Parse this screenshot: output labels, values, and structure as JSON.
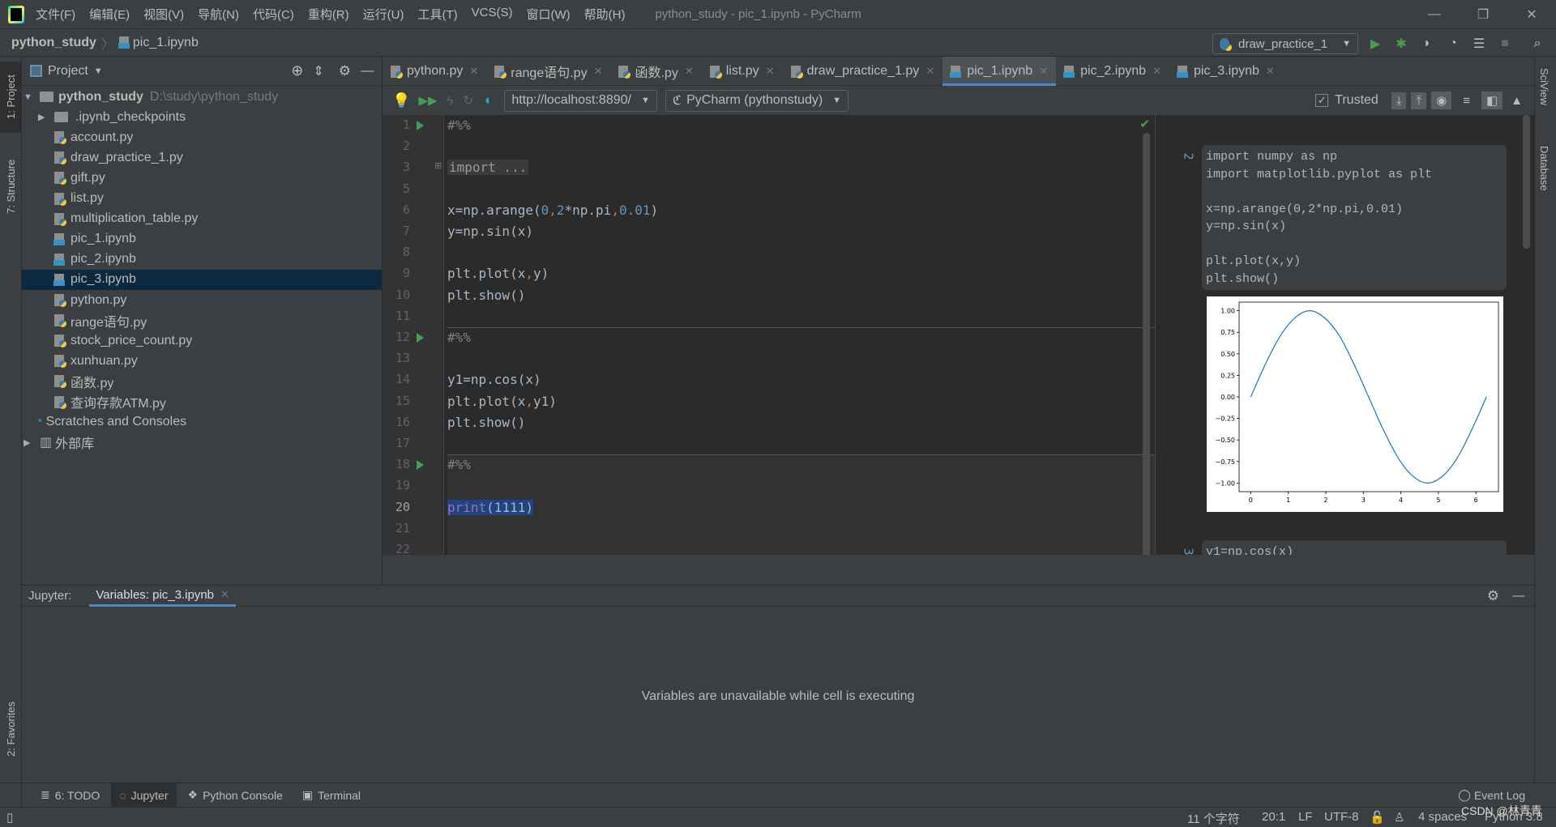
{
  "menu": {
    "items": [
      "文件(F)",
      "编辑(E)",
      "视图(V)",
      "导航(N)",
      "代码(C)",
      "重构(R)",
      "运行(U)",
      "工具(T)",
      "VCS(S)",
      "窗口(W)",
      "帮助(H)"
    ],
    "window_title": "python_study - pic_1.ipynb - PyCharm"
  },
  "navbar": {
    "project": "python_study",
    "file": "pic_1.ipynb",
    "run_config": "draw_practice_1"
  },
  "left_strip": {
    "project_tab": "1: Project",
    "structure_tab": "7: Structure",
    "favorites_tab": "2: Favorites"
  },
  "right_strip": {
    "sciview": "SciView",
    "database": "Database"
  },
  "project_panel": {
    "title": "Project",
    "root": {
      "name": "python_study",
      "path": "D:\\study\\python_study"
    },
    "items": [
      {
        "name": ".ipynb_checkpoints",
        "type": "folder"
      },
      {
        "name": "account.py",
        "type": "py"
      },
      {
        "name": "draw_practice_1.py",
        "type": "py"
      },
      {
        "name": "gift.py",
        "type": "py"
      },
      {
        "name": "list.py",
        "type": "py"
      },
      {
        "name": "multiplication_table.py",
        "type": "py"
      },
      {
        "name": "pic_1.ipynb",
        "type": "ipynb"
      },
      {
        "name": "pic_2.ipynb",
        "type": "ipynb"
      },
      {
        "name": "pic_3.ipynb",
        "type": "ipynb",
        "selected": true
      },
      {
        "name": "python.py",
        "type": "py"
      },
      {
        "name": "range语句.py",
        "type": "py"
      },
      {
        "name": "stock_price_count.py",
        "type": "py"
      },
      {
        "name": "xunhuan.py",
        "type": "py"
      },
      {
        "name": "函数.py",
        "type": "py"
      },
      {
        "name": "查询存款ATM.py",
        "type": "py"
      }
    ],
    "scratches": "Scratches and Consoles",
    "external_libs": "外部库"
  },
  "editor_tabs": [
    {
      "label": "python.py",
      "type": "py"
    },
    {
      "label": "range语句.py",
      "type": "py"
    },
    {
      "label": "函数.py",
      "type": "py"
    },
    {
      "label": "list.py",
      "type": "py"
    },
    {
      "label": "draw_practice_1.py",
      "type": "py"
    },
    {
      "label": "pic_1.ipynb",
      "type": "ipynb",
      "active": true
    },
    {
      "label": "pic_2.ipynb",
      "type": "ipynb"
    },
    {
      "label": "pic_3.ipynb",
      "type": "ipynb"
    }
  ],
  "editor_toolbar": {
    "server_url": "http://localhost:8890/",
    "interpreter": "PyCharm (pythonstudy)",
    "trusted_label": "Trusted",
    "trusted": true
  },
  "code_lines": [
    {
      "n": "1",
      "html": "<span class='cm'>#%%</span>",
      "run": true
    },
    {
      "n": "2",
      "html": ""
    },
    {
      "n": "3",
      "html": "<span class='fold'>import ...</span>"
    },
    {
      "n": "5",
      "html": ""
    },
    {
      "n": "6",
      "html": "x=np.arange(<span class='num'>0</span><span class='op'>,</span><span class='num'>2</span>*np.pi<span class='op'>,</span><span class='num'>0.01</span>)"
    },
    {
      "n": "7",
      "html": "y=np.sin(x)"
    },
    {
      "n": "8",
      "html": ""
    },
    {
      "n": "9",
      "html": "plt.plot(x<span class='op'>,</span>y)"
    },
    {
      "n": "10",
      "html": "plt.show()"
    },
    {
      "n": "11",
      "html": ""
    },
    {
      "n": "12",
      "html": "<span class='cm'>#%%</span>",
      "run": true
    },
    {
      "n": "13",
      "html": ""
    },
    {
      "n": "14",
      "html": "y1=np.cos(x)"
    },
    {
      "n": "15",
      "html": "plt.plot(x<span class='op'>,</span>y1)"
    },
    {
      "n": "16",
      "html": "plt.show()"
    },
    {
      "n": "17",
      "html": ""
    },
    {
      "n": "18",
      "html": "<span class='cm'>#%%</span>",
      "run": true
    },
    {
      "n": "19",
      "html": ""
    },
    {
      "n": "20",
      "html": "<span class='selc'><span style='color:#9876aa'>print</span>(1111)</span>"
    },
    {
      "n": "21",
      "html": ""
    },
    {
      "n": "22",
      "html": ""
    }
  ],
  "preview": {
    "cell2_number": "2",
    "cell2_code": "import numpy as np\nimport matplotlib.pyplot as plt\n\nx=np.arange(0,2*np.pi,0.01)\ny=np.sin(x)\n\nplt.plot(x,y)\nplt.show()",
    "cell3_number": "3",
    "cell3_code": "y1=np.cos(x)"
  },
  "chart_data": {
    "type": "line",
    "title": "",
    "xlabel": "",
    "ylabel": "",
    "xlim": [
      -0.31,
      6.6
    ],
    "ylim": [
      -1.1,
      1.1
    ],
    "xticks": [
      "0",
      "1",
      "2",
      "3",
      "4",
      "5",
      "6"
    ],
    "yticks": [
      "1.00",
      "0.75",
      "0.50",
      "0.25",
      "0.00",
      "−0.25",
      "−0.50",
      "−0.75",
      "−1.00"
    ],
    "grid": false,
    "series": [
      {
        "color": "#1f77b4",
        "x": [
          0,
          0.39,
          0.79,
          1.18,
          1.57,
          1.96,
          2.36,
          2.75,
          3.14,
          3.53,
          3.93,
          4.32,
          4.71,
          5.11,
          5.5,
          5.89,
          6.28
        ],
        "y": [
          0,
          0.38,
          0.71,
          0.92,
          1.0,
          0.92,
          0.71,
          0.38,
          0,
          -0.38,
          -0.71,
          -0.92,
          -1.0,
          -0.92,
          -0.71,
          -0.38,
          0
        ]
      }
    ]
  },
  "bottom_panel": {
    "prefix": "Jupyter:",
    "tab": "Variables: pic_3.ipynb",
    "message": "Variables are unavailable while cell is executing"
  },
  "tool_windows": [
    "6: TODO",
    "Jupyter",
    "Python Console",
    "Terminal"
  ],
  "event_log": "Event Log",
  "status": {
    "chars": "11 个字符",
    "position": "20:1",
    "line_sep": "LF",
    "encoding": "UTF-8",
    "indent": "4 spaces",
    "interpreter": "Python 3.8",
    "watermark": "CSDN @林青青"
  }
}
